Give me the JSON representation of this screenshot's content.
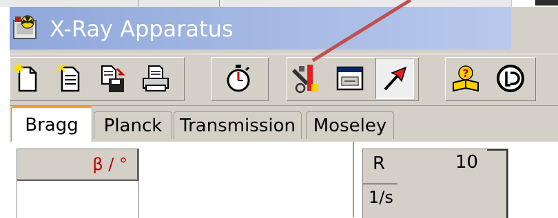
{
  "window": {
    "title": "X-Ray Apparatus"
  },
  "toolbar": {
    "buttons": [
      {
        "icon": "new-file-icon"
      },
      {
        "icon": "open-file-icon"
      },
      {
        "icon": "save-file-icon"
      },
      {
        "icon": "print-icon"
      },
      {
        "icon": "stopwatch-icon"
      },
      {
        "icon": "settings-tools-icon"
      },
      {
        "icon": "display-window-icon"
      },
      {
        "icon": "pointer-arrow-icon",
        "pressed": true
      },
      {
        "icon": "help-book-icon"
      },
      {
        "icon": "ld-logo-icon"
      }
    ]
  },
  "tabs": [
    {
      "label": "Bragg",
      "active": true
    },
    {
      "label": "Planck"
    },
    {
      "label": "Transmission"
    },
    {
      "label": "Moseley"
    }
  ],
  "table_left": {
    "column_header": "β / °"
  },
  "table_right": {
    "label": "R",
    "value": "10",
    "unit": "1/s"
  },
  "colors": {
    "accent_tab": "#f0a040",
    "title_gradient_start": "#8fa7da",
    "annotation_arrow": "#c0504d"
  }
}
